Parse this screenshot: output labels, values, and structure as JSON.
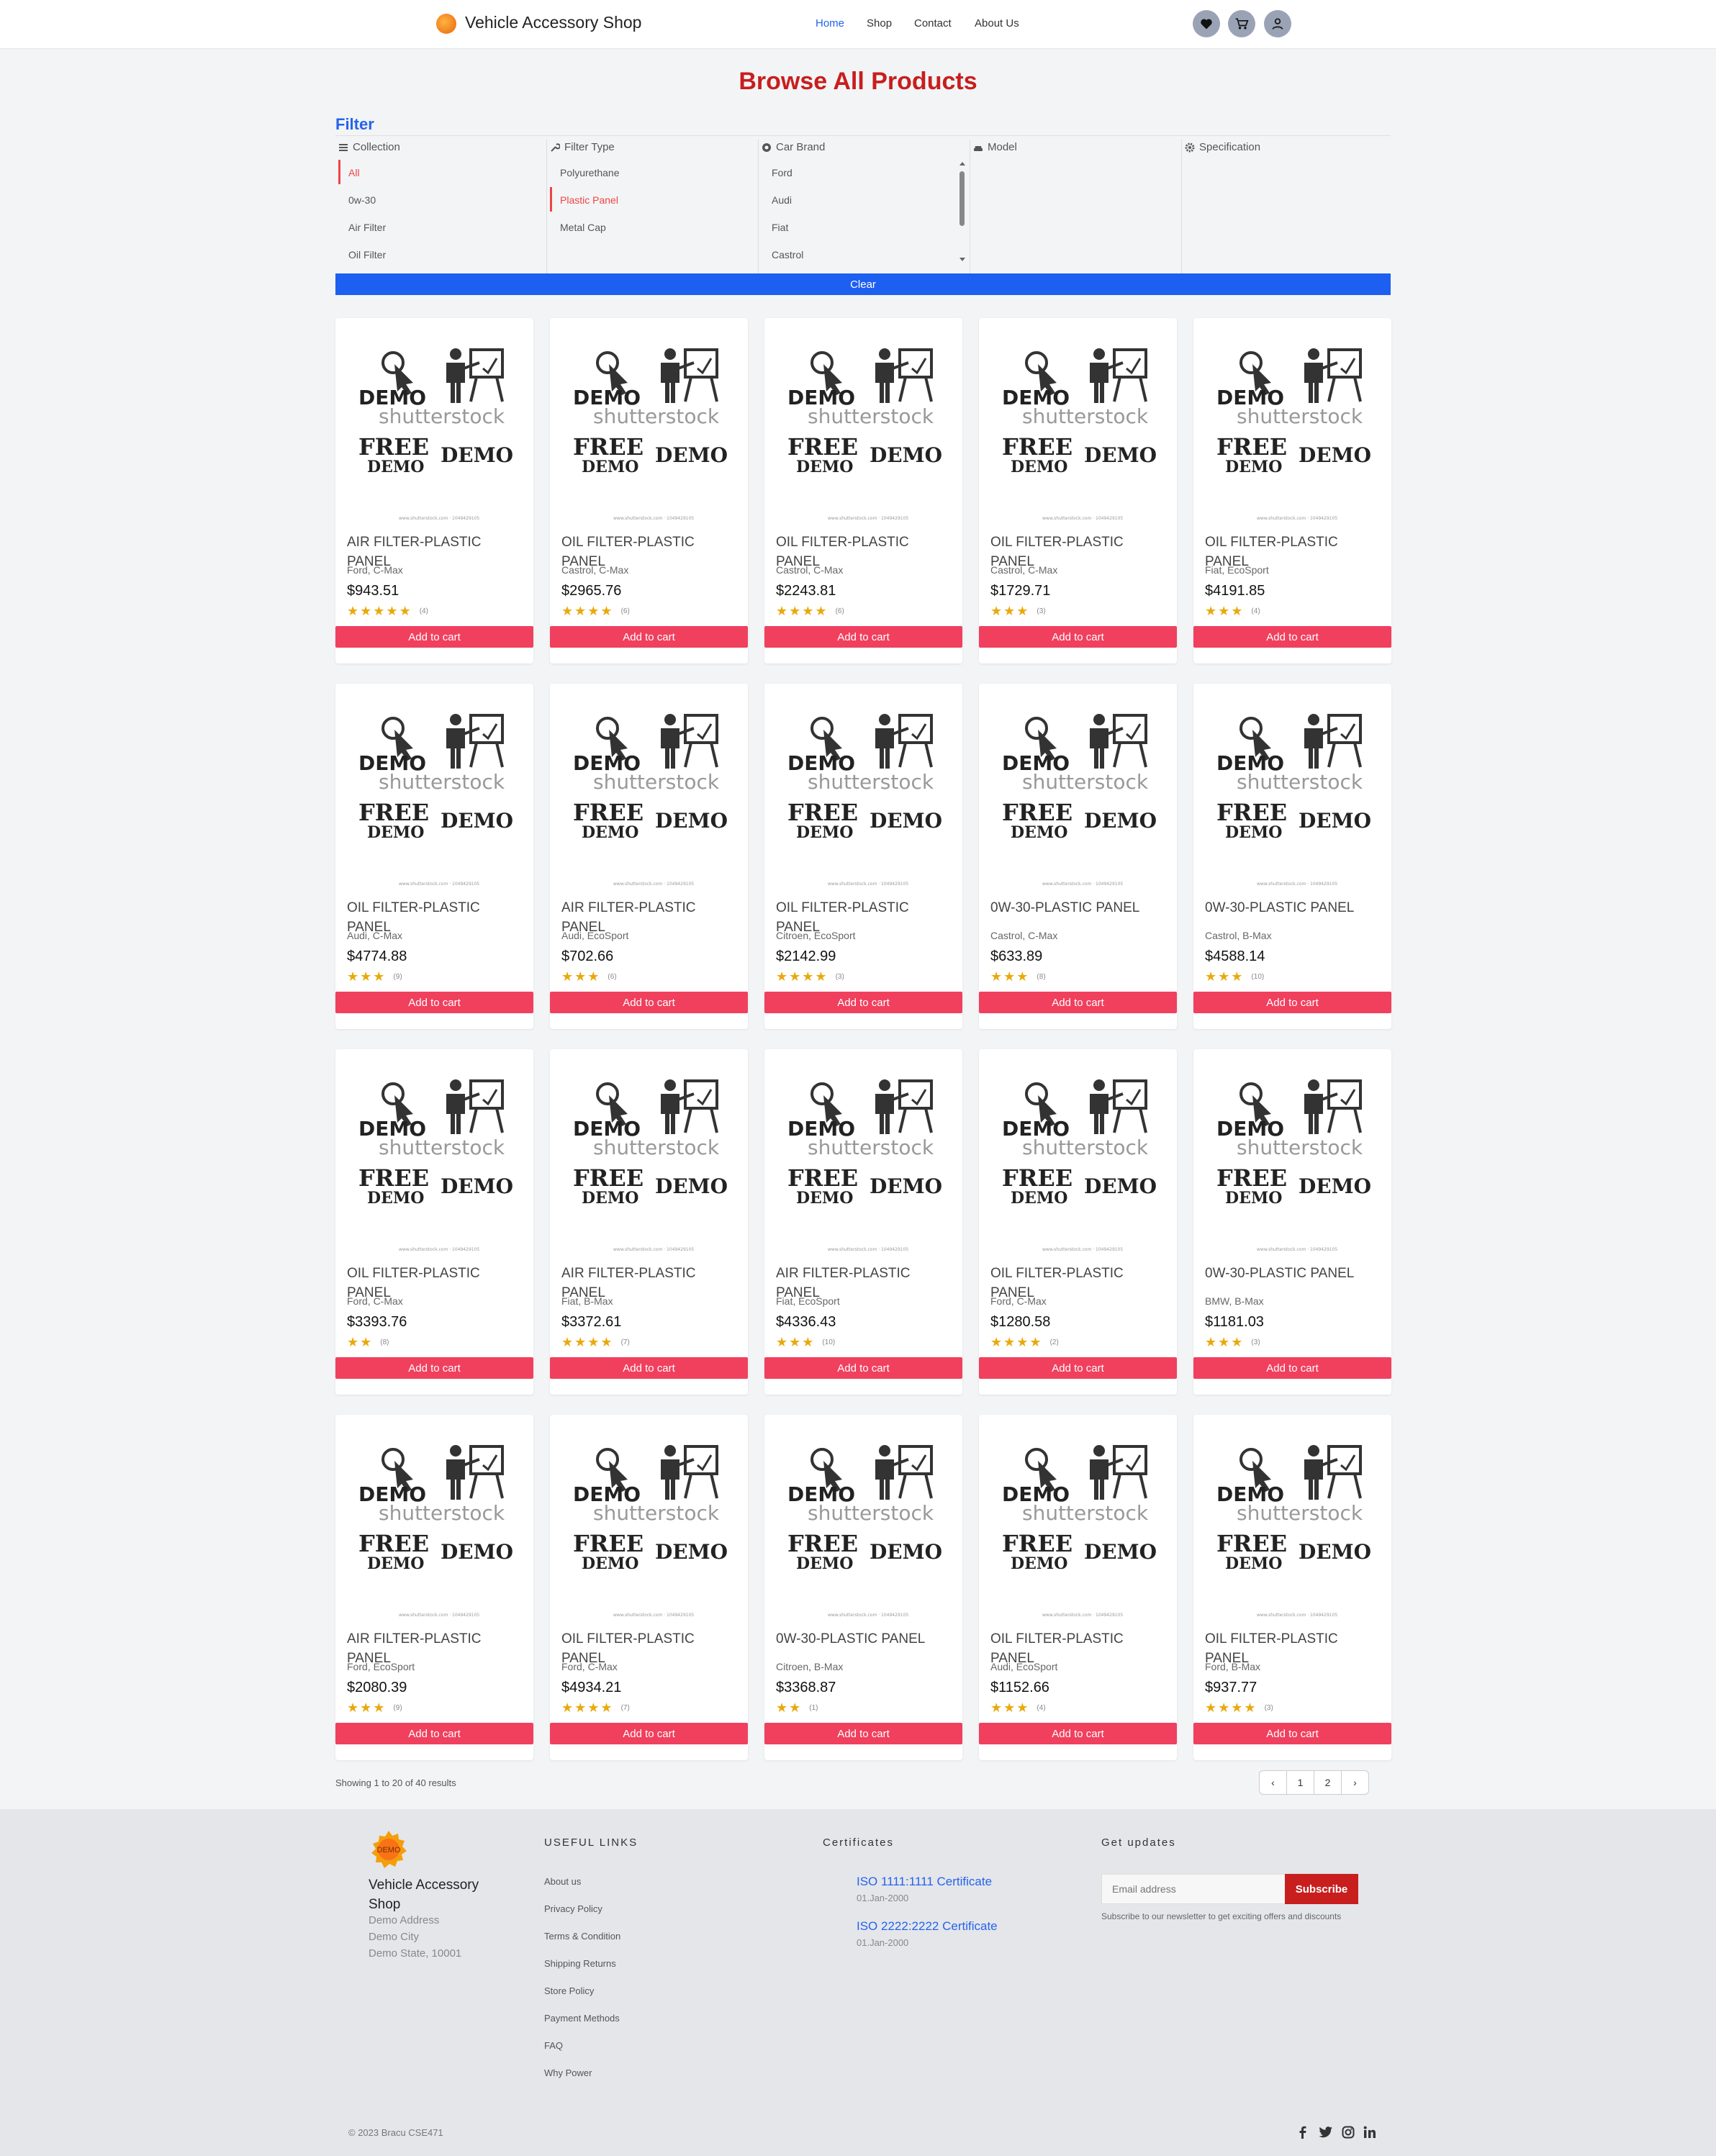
{
  "header": {
    "brand": "Vehicle Accessory Shop",
    "nav": [
      "Home",
      "Shop",
      "Contact",
      "About Us"
    ],
    "icons": [
      "heart-icon",
      "cart-icon",
      "user-icon"
    ],
    "accent_color": "#2563eb"
  },
  "page": {
    "title": "Browse All Products"
  },
  "filter": {
    "title": "Filter",
    "columns": [
      {
        "label": "Collection",
        "icon": "list-icon",
        "options": [
          "All",
          "0w-30",
          "Air Filter",
          "Oil Filter"
        ],
        "selected": "All"
      },
      {
        "label": "Filter Type",
        "icon": "wrench-icon",
        "options": [
          "Polyurethane",
          "Plastic Panel",
          "Metal Cap"
        ],
        "selected": "Plastic Panel"
      },
      {
        "label": "Car Brand",
        "icon": "brand-icon",
        "options": [
          "Ford",
          "Audi",
          "Fiat",
          "Castrol"
        ]
      },
      {
        "label": "Model",
        "icon": "car-icon",
        "options": []
      },
      {
        "label": "Specification",
        "icon": "gear-icon",
        "options": []
      }
    ],
    "clear_label": "Clear"
  },
  "products": [
    {
      "name": "Air Filter-Plastic Panel",
      "meta": "Ford, C-Max",
      "price": "$943.51",
      "stars": 5,
      "count": "(4)"
    },
    {
      "name": "Oil Filter-Plastic Panel",
      "meta": "Castrol, C-Max",
      "price": "$2965.76",
      "stars": 4,
      "count": "(6)"
    },
    {
      "name": "Oil Filter-Plastic Panel",
      "meta": "Castrol, C-Max",
      "price": "$2243.81",
      "stars": 4,
      "count": "(6)"
    },
    {
      "name": "Oil Filter-Plastic Panel",
      "meta": "Castrol, C-Max",
      "price": "$1729.71",
      "stars": 3,
      "count": "(3)"
    },
    {
      "name": "Oil Filter-Plastic Panel",
      "meta": "Fiat, EcoSport",
      "price": "$4191.85",
      "stars": 3,
      "count": "(4)"
    },
    {
      "name": "Oil Filter-Plastic Panel",
      "meta": "Audi, C-Max",
      "price": "$4774.88",
      "stars": 3,
      "count": "(9)"
    },
    {
      "name": "Air Filter-Plastic Panel",
      "meta": "Audi, EcoSport",
      "price": "$702.66",
      "stars": 3,
      "count": "(6)"
    },
    {
      "name": "Oil Filter-Plastic Panel",
      "meta": "Citroen, EcoSport",
      "price": "$2142.99",
      "stars": 4,
      "count": "(3)"
    },
    {
      "name": "0W-30-Plastic Panel",
      "meta": "Castrol, C-Max",
      "price": "$633.89",
      "stars": 3,
      "count": "(8)"
    },
    {
      "name": "0W-30-Plastic Panel",
      "meta": "Castrol, B-Max",
      "price": "$4588.14",
      "stars": 3,
      "count": "(10)"
    },
    {
      "name": "Oil Filter-Plastic Panel",
      "meta": "Ford, C-Max",
      "price": "$3393.76",
      "stars": 2,
      "count": "(8)"
    },
    {
      "name": "Air Filter-Plastic Panel",
      "meta": "Fiat, B-Max",
      "price": "$3372.61",
      "stars": 4,
      "count": "(7)"
    },
    {
      "name": "Air Filter-Plastic Panel",
      "meta": "Fiat, EcoSport",
      "price": "$4336.43",
      "stars": 3,
      "count": "(10)"
    },
    {
      "name": "Oil Filter-Plastic Panel",
      "meta": "Ford, C-Max",
      "price": "$1280.58",
      "stars": 4,
      "count": "(2)"
    },
    {
      "name": "0W-30-Plastic Panel",
      "meta": "BMW, B-Max",
      "price": "$1181.03",
      "stars": 3,
      "count": "(3)"
    },
    {
      "name": "Air Filter-Plastic Panel",
      "meta": "Ford, EcoSport",
      "price": "$2080.39",
      "stars": 3,
      "count": "(9)"
    },
    {
      "name": "Oil Filter-Plastic Panel",
      "meta": "Ford, C-Max",
      "price": "$4934.21",
      "stars": 4,
      "count": "(7)"
    },
    {
      "name": "0W-30-Plastic Panel",
      "meta": "Citroen, B-Max",
      "price": "$3368.87",
      "stars": 2,
      "count": "(1)"
    },
    {
      "name": "Oil Filter-Plastic Panel",
      "meta": "Audi, EcoSport",
      "price": "$1152.66",
      "stars": 3,
      "count": "(4)"
    },
    {
      "name": "Oil Filter-Plastic Panel",
      "meta": "Ford, B-Max",
      "price": "$937.77",
      "stars": 4,
      "count": "(3)"
    }
  ],
  "product_image": {
    "demo": "DEMO",
    "brand": "shutterstock",
    "free": "FREE",
    "free_sub": "DEMO",
    "demo2": "DEMO",
    "fine": "www.shutterstock.com · 1049429105"
  },
  "add_to_cart_label": "Add to cart",
  "pagination": {
    "showing": "Showing 1 to 20 of 40 results",
    "pages": [
      "1",
      "2"
    ],
    "prev": "‹",
    "next": "›"
  },
  "footer": {
    "badge_text": "DEMO",
    "brand": "Vehicle Accessory Shop",
    "address": [
      "Demo Address",
      "Demo City",
      "Demo State, 10001"
    ],
    "useful_links_title": "USEFUL LINKS",
    "useful_links": [
      "About us",
      "Privacy Policy",
      "Terms & Condition",
      "Shipping Returns",
      "Store Policy",
      "Payment Methods",
      "FAQ",
      "Why Power"
    ],
    "certificates_title": "Certificates",
    "certificates": [
      {
        "title": "ISO 1111:1111 Certificate",
        "date": "01.Jan-2000"
      },
      {
        "title": "ISO 2222:2222 Certificate",
        "date": "01.Jan-2000"
      }
    ],
    "updates_title": "Get updates",
    "email_placeholder": "Email address",
    "subscribe_label": "Subscribe",
    "note": "Subscribe to our newsletter to get exciting offers and discounts",
    "copyright": "© 2023 Bracu CSE471",
    "social": [
      "f",
      "t",
      "ig",
      "in"
    ]
  }
}
